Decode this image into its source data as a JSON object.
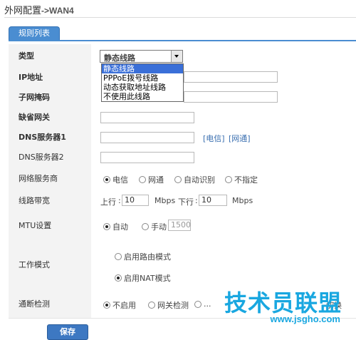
{
  "header": {
    "title": "外网配置",
    "separator": "->",
    "subtitle": "WAN4"
  },
  "tabs": [
    {
      "label": "规则列表"
    }
  ],
  "form": {
    "type": {
      "label": "类型",
      "selected": "静态线路",
      "options": [
        "静态线路",
        "PPPoE拨号线路",
        "动态获取地址线路",
        "不使用此线路"
      ]
    },
    "ip": {
      "label": "IP地址",
      "value": ""
    },
    "mask": {
      "label": "子网掩码",
      "value": ""
    },
    "gateway": {
      "label": "缺省网关",
      "value": ""
    },
    "dns1": {
      "label": "DNS服务器1",
      "value": "",
      "links": [
        "[电信]",
        "[网通]"
      ]
    },
    "dns2": {
      "label": "DNS服务器2",
      "value": ""
    },
    "isp": {
      "label": "网络服务商",
      "options": [
        "电信",
        "网通",
        "自动识别",
        "不指定"
      ],
      "selected": "电信"
    },
    "bandwidth": {
      "label": "线路带宽",
      "up_label": "上行",
      "up_value": "10",
      "unit": "Mbps",
      "down_label": "下行",
      "down_value": "10"
    },
    "mtu": {
      "label": "MTU设置",
      "auto_label": "自动",
      "manual_label": "手动",
      "value": "1500",
      "selected": "自动"
    },
    "mode": {
      "label": "工作模式",
      "options": [
        "启用路由模式",
        "启用NAT模式"
      ],
      "selected": "启用NAT模式"
    },
    "detect": {
      "label": "通断检测",
      "options": [
        "不启用",
        "网关检测",
        "...",
        "切换"
      ],
      "selected": "不启用"
    }
  },
  "buttons": {
    "save": "保存"
  },
  "watermark": {
    "text": "技术员联盟",
    "url": "www.jsgho.com"
  }
}
